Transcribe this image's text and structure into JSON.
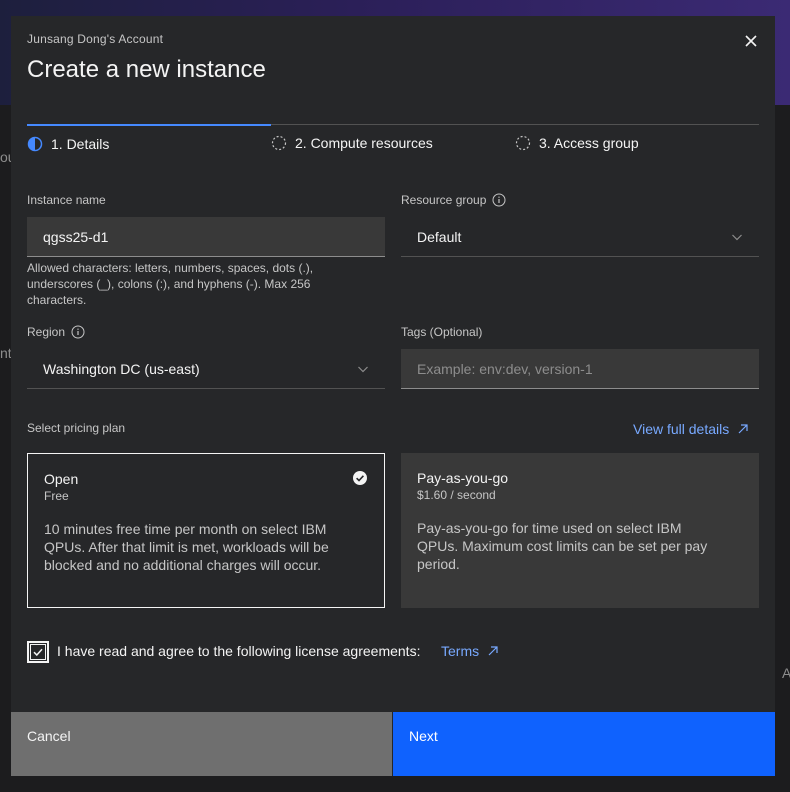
{
  "modal": {
    "account": "Junsang Dong's Account",
    "title": "Create a new instance"
  },
  "steps": [
    {
      "label": "1. Details",
      "state": "current"
    },
    {
      "label": "2. Compute resources",
      "state": "incomplete"
    },
    {
      "label": "3. Access group",
      "state": "incomplete"
    }
  ],
  "form": {
    "instance_name_label": "Instance name",
    "instance_name_value": "qgss25-d1",
    "instance_name_helper": "Allowed characters: letters, numbers, spaces, dots (.), underscores (_), colons (:), and hyphens (-). Max 256 characters.",
    "resource_group_label": "Resource group",
    "resource_group_value": "Default",
    "region_label": "Region",
    "region_value": "Washington DC (us-east)",
    "tags_label": "Tags (Optional)",
    "tags_placeholder": "Example: env:dev, version-1"
  },
  "pricing": {
    "label": "Select pricing plan",
    "details_link": "View full details",
    "plans": [
      {
        "name": "Open",
        "price": "Free",
        "description": "10 minutes free time per month on select IBM QPUs. After that limit is met, workloads will be blocked and no additional charges will occur.",
        "selected": true
      },
      {
        "name": "Pay-as-you-go",
        "price": "$1.60 / second",
        "description": "Pay-as-you-go for time used on select IBM QPUs. Maximum cost limits can be set per pay period.",
        "selected": false
      }
    ]
  },
  "agreement": {
    "text": "I have read and agree to the following license agreements:",
    "link": "Terms",
    "checked": true
  },
  "buttons": {
    "cancel": "Cancel",
    "next": "Next"
  },
  "background": {
    "left_fragment_1": "ou",
    "left_fragment_2": "nt",
    "right_fragment": "A"
  },
  "colors": {
    "accent": "#0f62fe",
    "link": "#78a9ff",
    "modal_bg": "#262729"
  }
}
